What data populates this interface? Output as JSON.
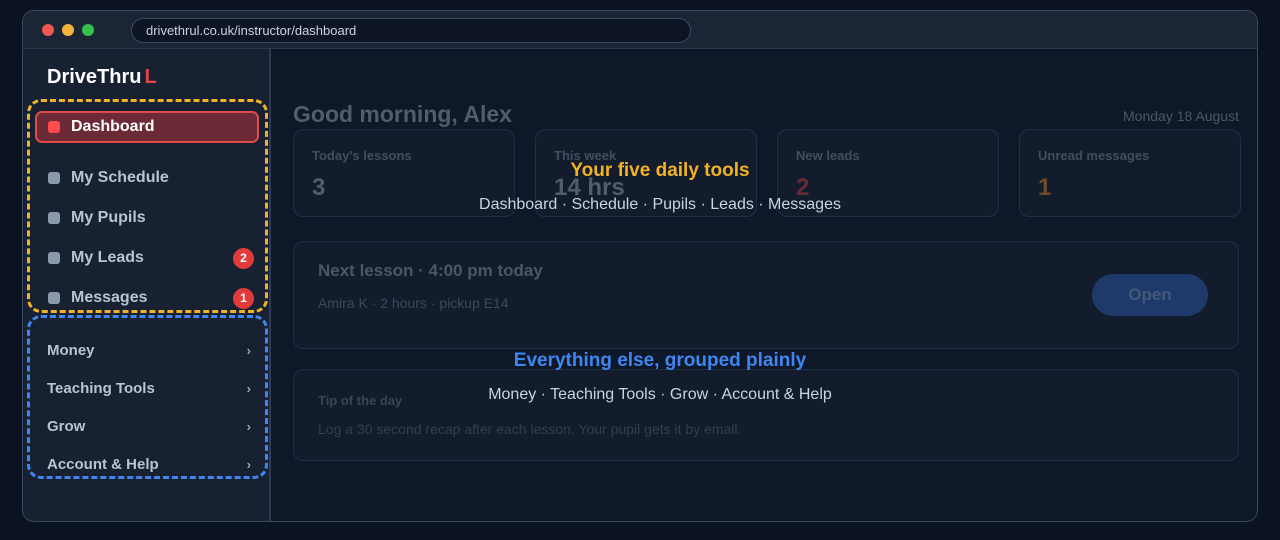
{
  "browser": {
    "url": "drivethrul.co.uk/instructor/dashboard"
  },
  "sidebar": {
    "logo": {
      "text": "DriveThru",
      "accent": "L"
    },
    "primary": [
      {
        "label": "Dashboard",
        "active": true
      },
      {
        "label": "My Schedule"
      },
      {
        "label": "My Pupils"
      },
      {
        "label": "My Leads",
        "badge": "2"
      },
      {
        "label": "Messages",
        "badge": "1"
      }
    ],
    "groups": [
      {
        "label": "Money",
        "chevron": "›"
      },
      {
        "label": "Teaching Tools",
        "chevron": "›"
      },
      {
        "label": "Grow",
        "chevron": "›"
      },
      {
        "label": "Account & Help",
        "chevron": "›"
      }
    ]
  },
  "main": {
    "greeting": "Good morning, Alex",
    "date": "Monday 18 August",
    "stats": [
      {
        "label": "Today's lessons",
        "value": "3"
      },
      {
        "label": "This week",
        "value": "14 hrs"
      },
      {
        "label": "New leads",
        "value": "2"
      },
      {
        "label": "Unread messages",
        "value": "1"
      }
    ],
    "next_lesson": {
      "title": "Next lesson · 4:00 pm today",
      "details": "Amira K · 2 hours · pickup E14",
      "button": "Open"
    },
    "tip": {
      "title": "Tip of the day",
      "body": "Log a 30 second recap after each lesson. Your pupil gets it by email."
    }
  },
  "annotations": {
    "primary": {
      "title": "Your five daily tools",
      "subtitle": "Dashboard · Schedule · Pupils · Leads · Messages"
    },
    "secondary": {
      "title": "Everything else, grouped plainly",
      "subtitle": "Money · Teaching Tools · Grow · Account & Help"
    }
  },
  "colors": {
    "accent_red": "#e04a4a",
    "annotation_yellow": "#f3b21f",
    "annotation_blue": "#3f86f0"
  }
}
